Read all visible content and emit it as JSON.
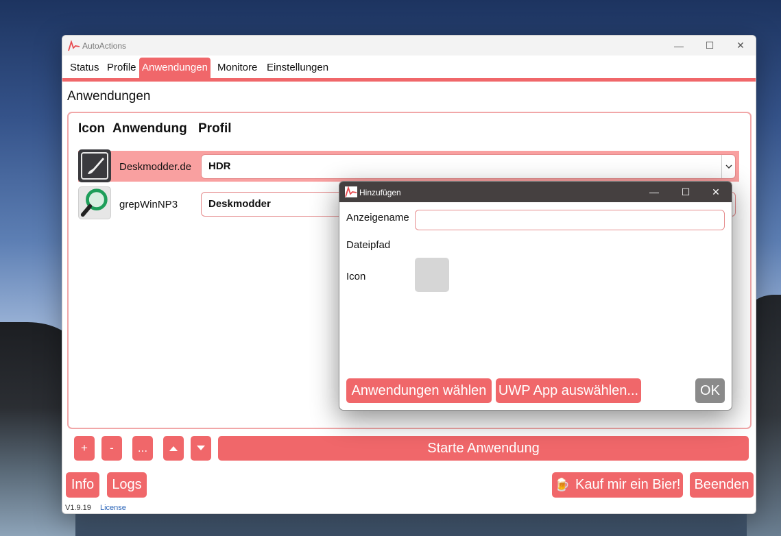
{
  "window": {
    "title": "AutoActions",
    "controls": {
      "minimize": "—",
      "maximize": "☐",
      "close": "✕"
    }
  },
  "tabs": [
    {
      "label": "Status",
      "active": false
    },
    {
      "label": "Profile",
      "active": false
    },
    {
      "label": "Anwendungen",
      "active": true
    },
    {
      "label": "Monitore",
      "active": false
    },
    {
      "label": "Einstellungen",
      "active": false
    }
  ],
  "section_title": "Anwendungen",
  "columns": {
    "icon": "Icon",
    "application": "Anwendung",
    "profile": "Profil"
  },
  "applications": [
    {
      "name": "Deskmodder.de",
      "profile": "HDR",
      "icon": "paintbrush-icon",
      "selected": true
    },
    {
      "name": "grepWinNP3",
      "profile": "Deskmodder",
      "icon": "magnifier-icon",
      "selected": false
    }
  ],
  "toolbar": {
    "add": "+",
    "remove": "-",
    "more": "...",
    "start": "Starte Anwendung"
  },
  "footer": {
    "info": "Info",
    "logs": "Logs",
    "beer": "Kauf mir ein Bier!",
    "quit": "Beenden",
    "version": "V1.9.19",
    "license": "License"
  },
  "dialog": {
    "title": "Hinzufügen",
    "display_name_label": "Anzeigename",
    "display_name_value": "",
    "file_path_label": "Dateipfad",
    "icon_label": "Icon",
    "choose_app": "Anwendungen wählen",
    "choose_uwp": "UWP App auswählen...",
    "ok": "OK"
  },
  "colors": {
    "accent": "#f0676a",
    "accent_light": "#f9a0a0",
    "dialog_titlebar": "#454040"
  }
}
